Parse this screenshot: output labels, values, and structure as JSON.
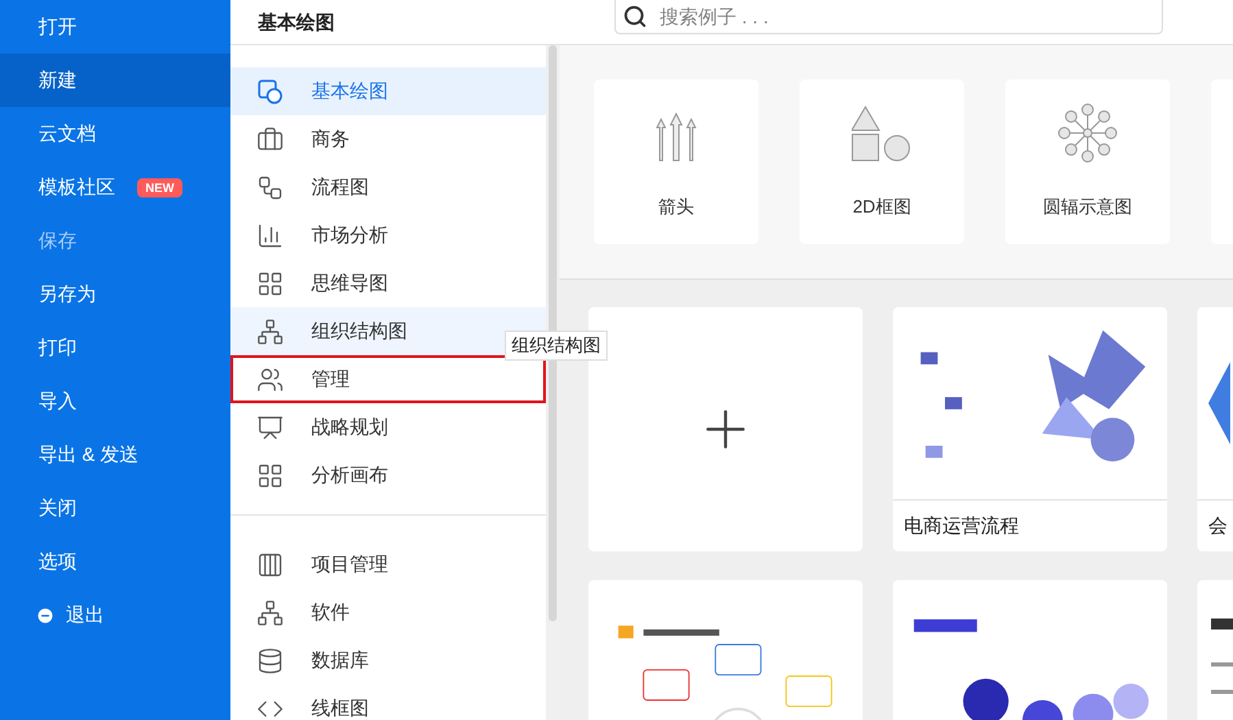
{
  "sidebar": {
    "items": [
      {
        "label": "打开",
        "selected": false,
        "disabled": false
      },
      {
        "label": "新建",
        "selected": true,
        "disabled": false
      },
      {
        "label": "云文档",
        "selected": false,
        "disabled": false
      },
      {
        "label": "模板社区",
        "selected": false,
        "disabled": false,
        "badge": "NEW"
      },
      {
        "label": "保存",
        "selected": false,
        "disabled": true
      },
      {
        "label": "另存为",
        "selected": false,
        "disabled": false
      },
      {
        "label": "打印",
        "selected": false,
        "disabled": false
      },
      {
        "label": "导入",
        "selected": false,
        "disabled": false
      },
      {
        "label": "导出 & 发送",
        "selected": false,
        "disabled": false
      },
      {
        "label": "关闭",
        "selected": false,
        "disabled": false
      },
      {
        "label": "选项",
        "selected": false,
        "disabled": false
      },
      {
        "label": "退出",
        "selected": false,
        "disabled": false,
        "kind": "exit"
      }
    ]
  },
  "categories": {
    "title": "基本绘图",
    "groups": [
      [
        {
          "label": "基本绘图",
          "selected": true,
          "hovered": false,
          "highlighted": false
        },
        {
          "label": "商务",
          "selected": false,
          "hovered": false,
          "highlighted": false
        },
        {
          "label": "流程图",
          "selected": false,
          "hovered": false,
          "highlighted": false
        },
        {
          "label": "市场分析",
          "selected": false,
          "hovered": false,
          "highlighted": false
        },
        {
          "label": "思维导图",
          "selected": false,
          "hovered": false,
          "highlighted": false
        },
        {
          "label": "组织结构图",
          "selected": false,
          "hovered": true,
          "highlighted": false,
          "tooltip": "组织结构图"
        },
        {
          "label": "管理",
          "selected": false,
          "hovered": false,
          "highlighted": true
        },
        {
          "label": "战略规划",
          "selected": false,
          "hovered": false,
          "highlighted": false
        },
        {
          "label": "分析画布",
          "selected": false,
          "hovered": false,
          "highlighted": false
        }
      ],
      [
        {
          "label": "项目管理",
          "selected": false,
          "hovered": false,
          "highlighted": false
        },
        {
          "label": "软件",
          "selected": false,
          "hovered": false,
          "highlighted": false
        },
        {
          "label": "数据库",
          "selected": false,
          "hovered": false,
          "highlighted": false
        },
        {
          "label": "线框图",
          "selected": false,
          "hovered": false,
          "highlighted": false
        }
      ]
    ]
  },
  "search": {
    "placeholder": "搜索例子 . . ."
  },
  "shape_cards": [
    {
      "label": "箭头"
    },
    {
      "label": "2D框图"
    },
    {
      "label": "圆辐示意图"
    }
  ],
  "templates": [
    {
      "kind": "new"
    },
    {
      "kind": "template",
      "title": "电商运营流程"
    },
    {
      "kind": "template",
      "title": "会"
    },
    {
      "kind": "template"
    },
    {
      "kind": "template"
    },
    {
      "kind": "template"
    }
  ]
}
